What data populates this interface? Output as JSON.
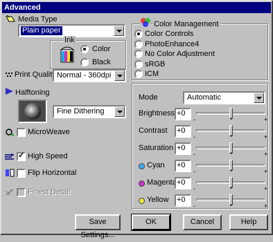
{
  "window": {
    "title": "Advanced"
  },
  "media_type": {
    "label": "Media Type",
    "value": "Plain paper"
  },
  "ink": {
    "label": "Ink",
    "options": [
      {
        "label": "Color",
        "selected": true
      },
      {
        "label": "Black",
        "selected": false
      }
    ]
  },
  "print_quality": {
    "label": "Print Quality",
    "value": "Normal - 360dpi"
  },
  "halftoning": {
    "label": "Halftoning",
    "value": "Fine Dithering"
  },
  "checkboxes": [
    {
      "label": "MicroWeave",
      "checked": false,
      "enabled": true
    },
    {
      "label": "High Speed",
      "checked": true,
      "enabled": true
    },
    {
      "label": "Flip Horizontal",
      "checked": false,
      "enabled": true
    },
    {
      "label": "Finest Detail",
      "checked": false,
      "enabled": false
    }
  ],
  "color_management": {
    "title": "Color Management",
    "options": [
      {
        "label": "Color Controls",
        "selected": true
      },
      {
        "label": "PhotoEnhance4",
        "selected": false
      },
      {
        "label": "No Color Adjustment",
        "selected": false
      },
      {
        "label": "sRGB",
        "selected": false
      },
      {
        "label": "ICM",
        "selected": false
      }
    ],
    "mode_label": "Mode",
    "mode_value": "Automatic",
    "sliders": [
      {
        "label": "Brightness",
        "value": "+0",
        "level": 0.5,
        "dot": ""
      },
      {
        "label": "Contrast",
        "value": "+0",
        "level": 0.5,
        "dot": ""
      },
      {
        "label": "Saturation",
        "value": "+0",
        "level": 0.5,
        "dot": ""
      },
      {
        "label": "Cyan",
        "value": "+0",
        "level": 0.5,
        "dot": "#3fa9f5"
      },
      {
        "label": "Magenta",
        "value": "+0",
        "level": 0.5,
        "dot": "#cc33cc"
      },
      {
        "label": "Yellow",
        "value": "+0",
        "level": 0.5,
        "dot": "#e8e840"
      }
    ],
    "minus_sign": "-",
    "plus_sign": "+"
  },
  "buttons": {
    "save": "Save Settings...",
    "ok": "OK",
    "cancel": "Cancel",
    "help": "Help"
  }
}
